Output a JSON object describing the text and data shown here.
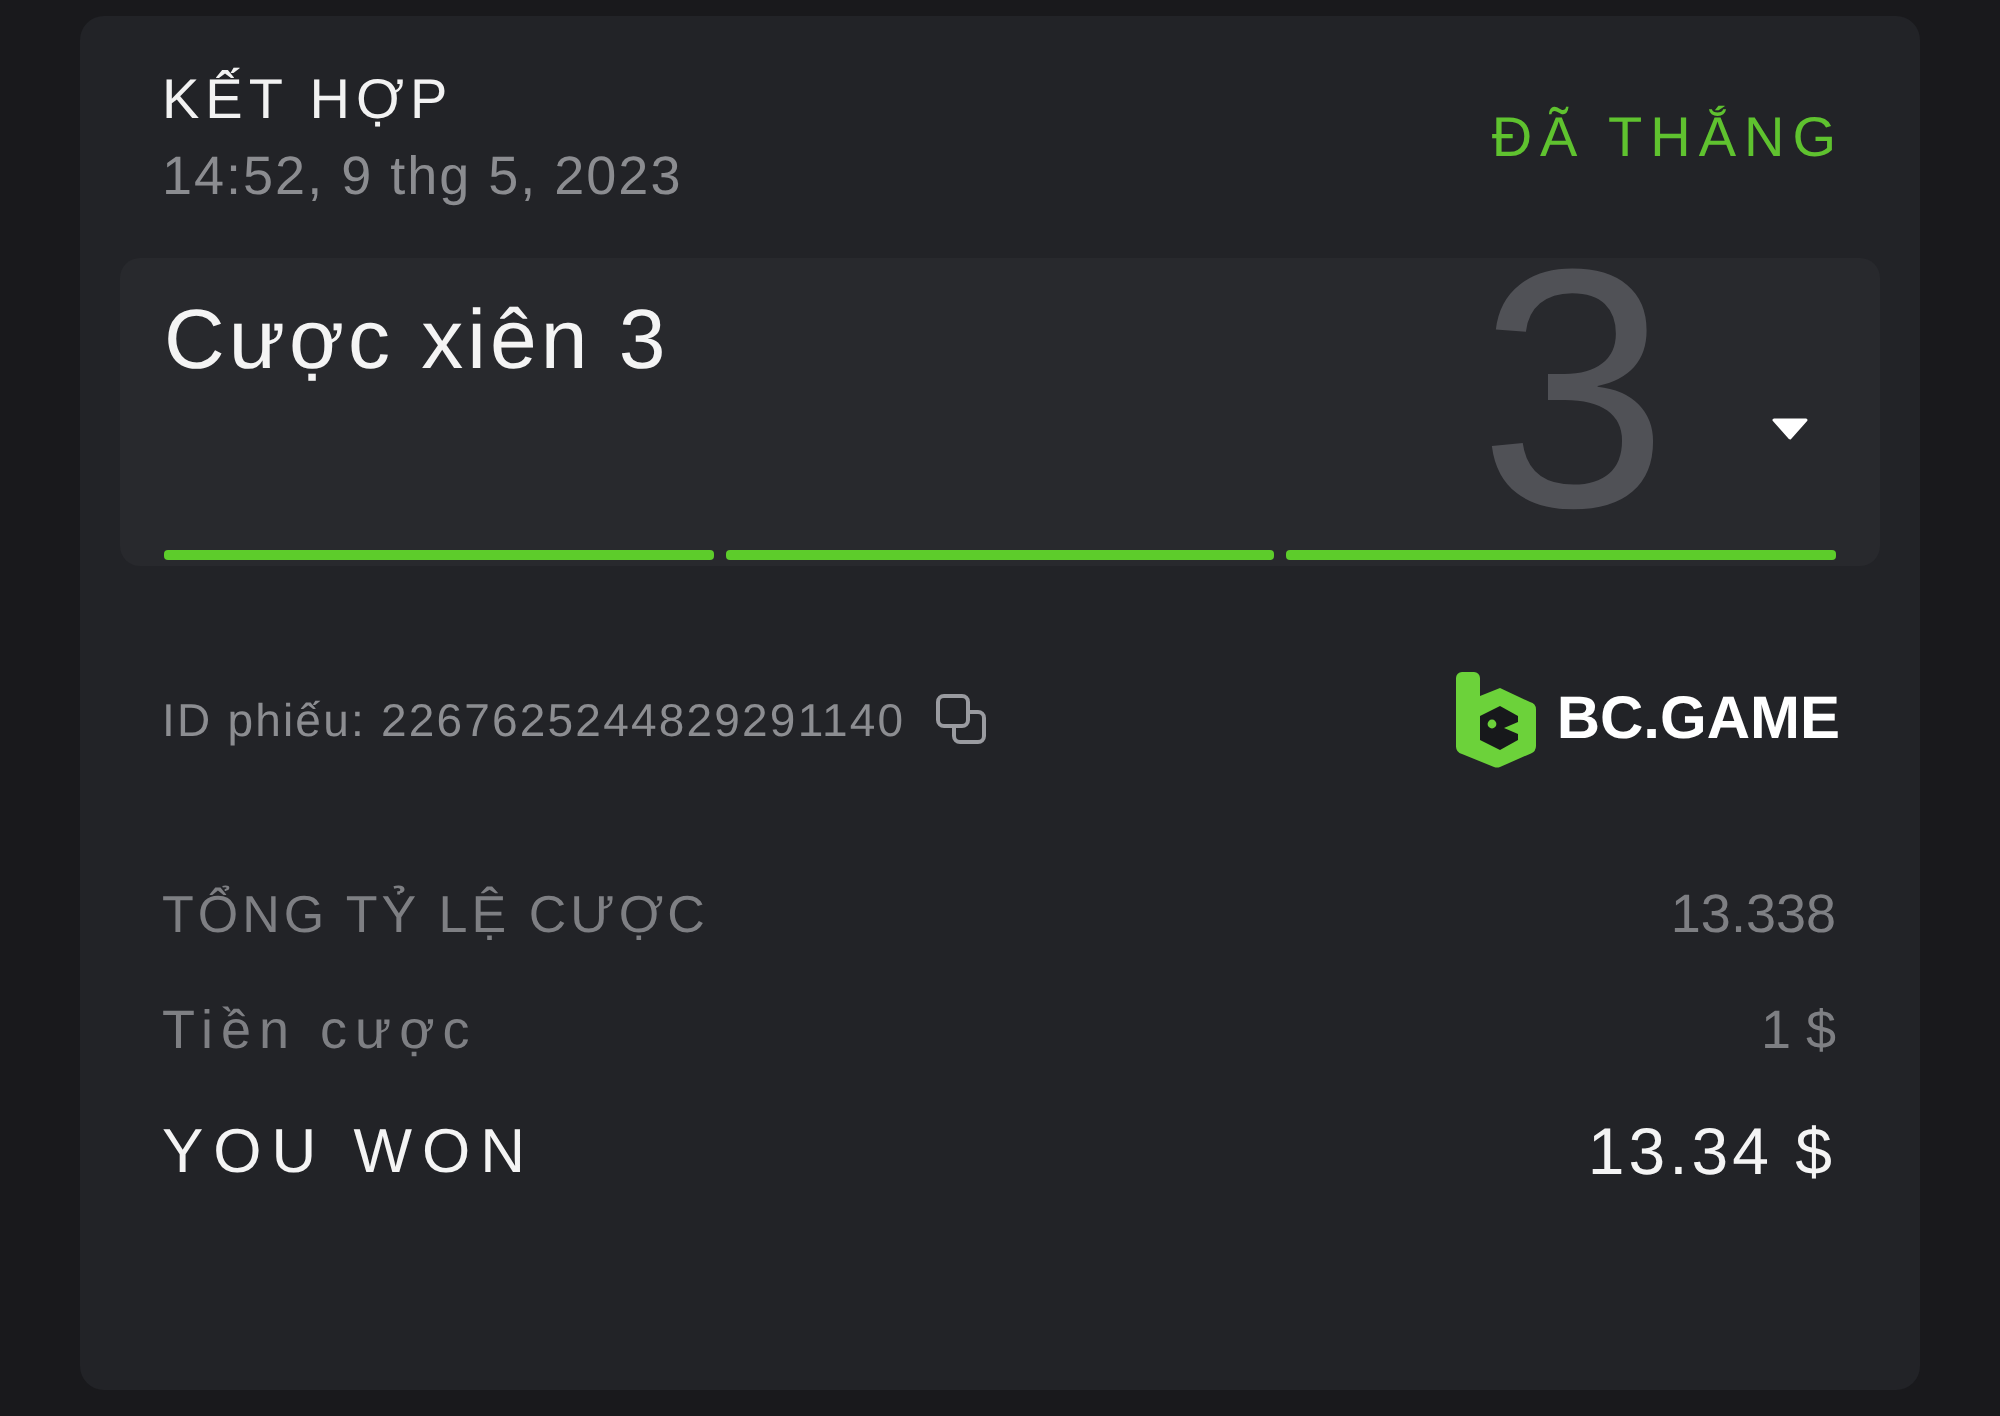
{
  "bet": {
    "type": "KẾT HỢP",
    "time": "14:52, 9 thg 5, 2023",
    "status": {
      "label": "ĐÃ THẮNG",
      "kind": "won"
    }
  },
  "parlay": {
    "title": "Cược xiên 3",
    "leg_count": "3",
    "expanded": false,
    "legs": [
      {
        "won": true
      },
      {
        "won": true
      },
      {
        "won": true
      }
    ]
  },
  "ticket": {
    "text": "ID phiếu: 2267625244829291140"
  },
  "brand": {
    "name": "BC.GAME"
  },
  "summary": [
    {
      "label": "TỔNG TỶ LỆ CƯỢC",
      "value": "13.338",
      "kind": "muted"
    },
    {
      "label": "Tiền cược",
      "value": "1 $",
      "kind": "muted"
    },
    {
      "label": "YOU WON",
      "value": "13.34 $",
      "kind": "total"
    }
  ]
}
